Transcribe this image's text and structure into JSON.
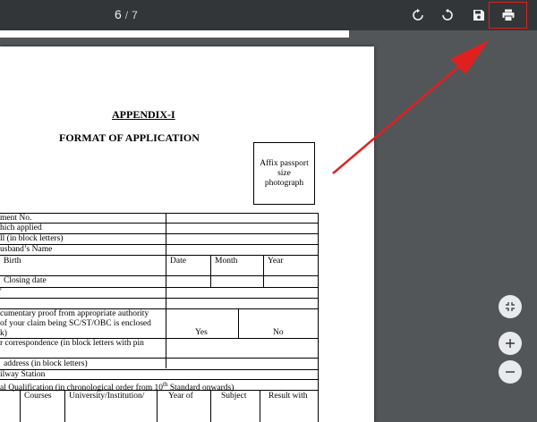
{
  "toolbar": {
    "current_page": "6",
    "separator": "/",
    "total_pages": "7",
    "icons": [
      "rotate-clockwise-icon",
      "rotate-counterclockwise-icon",
      "save-icon",
      "print-icon"
    ]
  },
  "document": {
    "heading": "APPENDIX-I",
    "subheading": "FORMAT OF APPLICATION",
    "photo_box": [
      "Affix passport",
      "size",
      "photograph"
    ],
    "rows": [
      "ment No.",
      "hich applied",
      "ll (in block letters)",
      "usband’s Name",
      "Birth",
      "Closing date",
      "'",
      "cumentary proof from appropriate authority",
      "of your claim being SC/ST/OBC is enclosed",
      "k)",
      "r correspondence (in block letters with pin",
      "address (in block letters)",
      "ilway Station",
      "al Qualification (in chronological order from 10",
      "th",
      " Standard onwards)"
    ],
    "birth_cols": [
      "Date",
      "Month",
      "Year"
    ],
    "yes_no": [
      "Yes",
      "No"
    ],
    "qual_cols": [
      "Courses",
      "University/Institution/",
      "Year of",
      "Subject",
      "Result with"
    ]
  },
  "zoom": {
    "fit_icon": "fit-to-page-icon",
    "zoom_in_icon": "zoom-in-icon",
    "zoom_out_icon": "zoom-out-icon"
  },
  "colors": {
    "toolbar_bg": "#323639",
    "viewer_bg": "#525659",
    "annotation": "#e02020"
  }
}
